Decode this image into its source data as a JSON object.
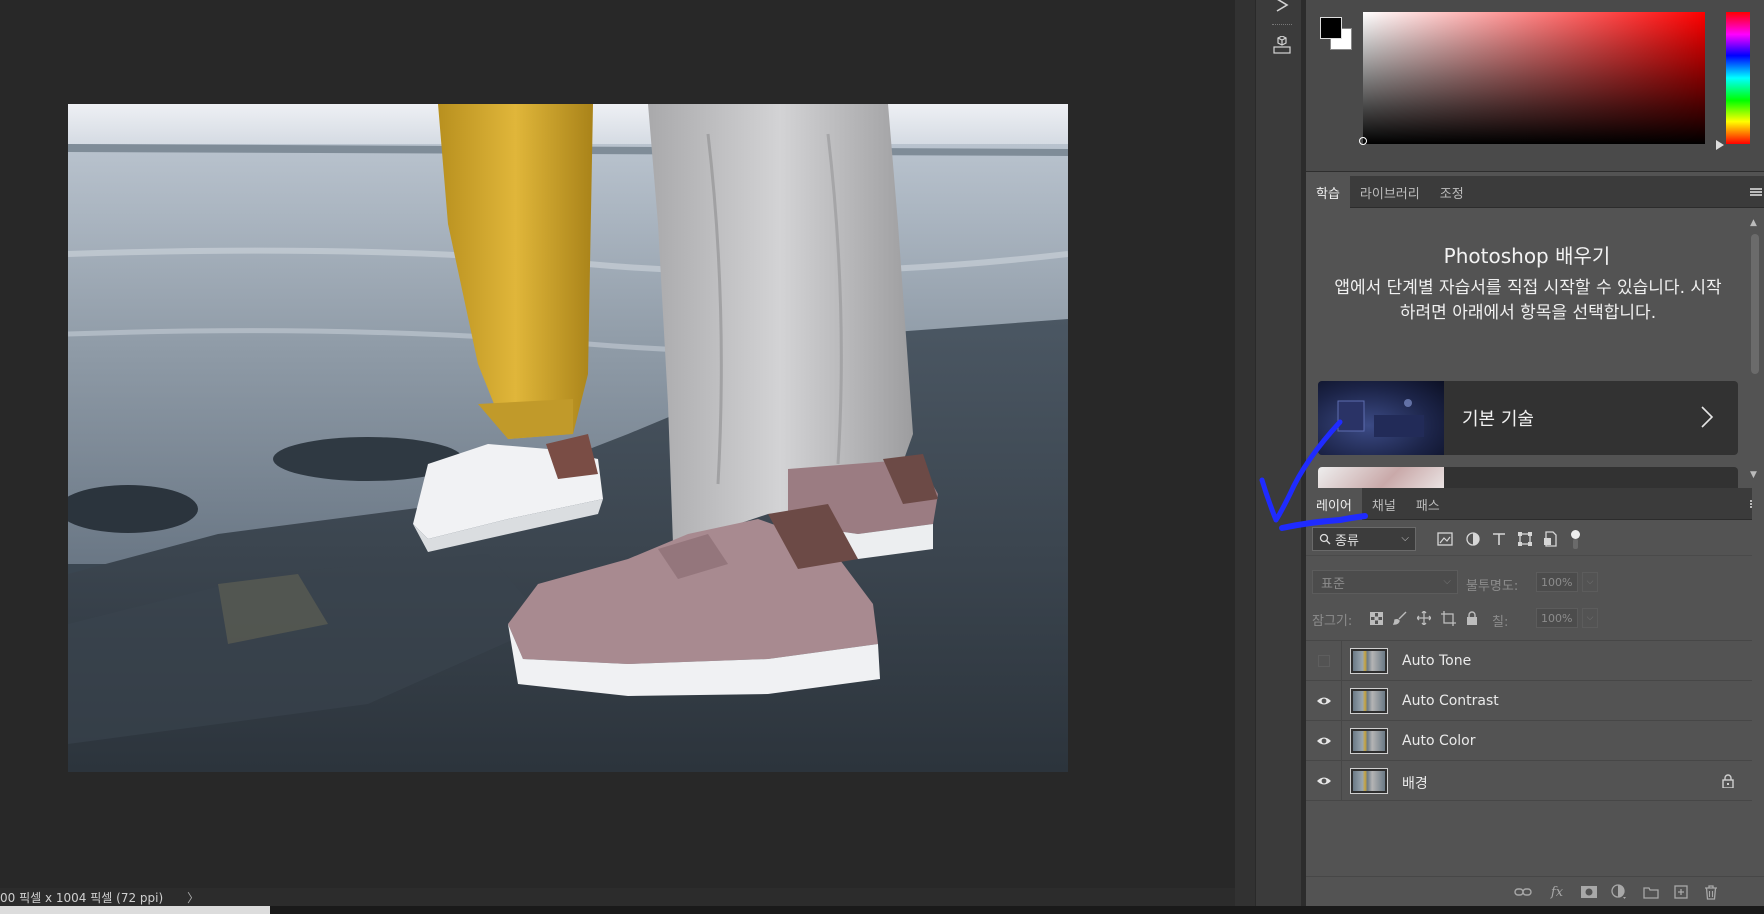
{
  "status": {
    "doc_info": "00 픽셀 x 1004 픽셀 (72 ppi)",
    "arrow": "〉"
  },
  "colors": {
    "foreground": "#000000",
    "background": "#ffffff",
    "annotation": "#1f2bff"
  },
  "learn_panel": {
    "tabs": [
      "학습",
      "라이브러리",
      "조정"
    ],
    "active_tab": "학습",
    "title": "Photoshop 배우기",
    "description": "앱에서 단계별 자습서를 직접 시작할 수 있습니다. 시작하려면 아래에서 항목을 선택합니다.",
    "tutorial_label": "기본 기술"
  },
  "layers_panel": {
    "tabs": [
      "레이어",
      "채널",
      "패스"
    ],
    "active_tab": "레이어",
    "kind_filter": "종류",
    "blend_mode": "표준",
    "opacity_label": "불투명도:",
    "opacity_value": "100%",
    "lock_label": "잠그기:",
    "fill_label": "칠:",
    "fill_value": "100%",
    "layers": [
      {
        "name": "Auto Tone",
        "visible": false,
        "locked": false
      },
      {
        "name": "Auto Contrast",
        "visible": true,
        "locked": false
      },
      {
        "name": "Auto Color",
        "visible": true,
        "locked": false
      },
      {
        "name": "배경",
        "visible": true,
        "locked": true
      }
    ]
  },
  "icons": {
    "dock": [
      "arrow-tool-icon",
      "3d-cube-icon"
    ],
    "filter": [
      "image-filter-icon",
      "adjustment-filter-icon",
      "type-filter-icon",
      "shape-filter-icon",
      "smart-object-filter-icon"
    ],
    "footer": [
      "link-layers-icon",
      "fx-icon",
      "mask-icon",
      "adjustment-layer-icon",
      "group-icon",
      "new-layer-icon",
      "delete-icon"
    ]
  }
}
